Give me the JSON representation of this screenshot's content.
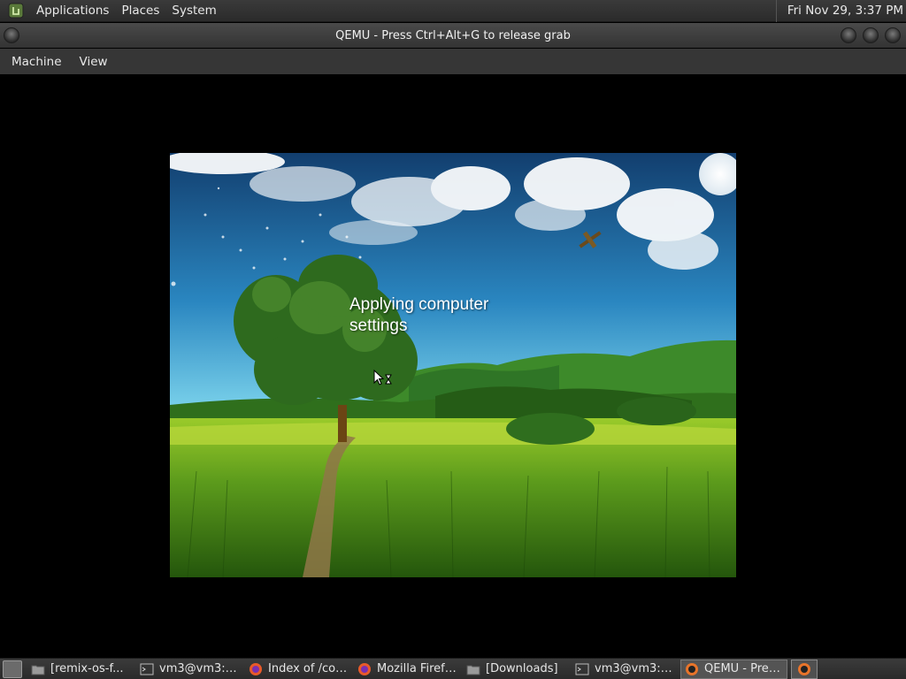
{
  "top_panel": {
    "menus": [
      "Applications",
      "Places",
      "System"
    ],
    "clock": "Fri Nov 29,  3:37 PM"
  },
  "window": {
    "title": "QEMU - Press Ctrl+Alt+G to release grab",
    "menubar": [
      "Machine",
      "View"
    ]
  },
  "guest": {
    "status_line1": "Applying computer",
    "status_line2": "settings"
  },
  "taskbar": {
    "items": [
      {
        "label": "[remix-os-f...",
        "icon": "folder-icon"
      },
      {
        "label": "vm3@vm3:~...",
        "icon": "terminal-icon"
      },
      {
        "label": "Index of /col...",
        "icon": "firefox-icon"
      },
      {
        "label": "Mozilla Firefox",
        "icon": "firefox-icon"
      },
      {
        "label": "[Downloads]",
        "icon": "folder-icon"
      },
      {
        "label": "vm3@vm3:~...",
        "icon": "terminal-icon"
      },
      {
        "label": "QEMU - Pres...",
        "icon": "qemu-icon",
        "active": true
      }
    ]
  },
  "colors": {
    "panel": "#2b2b2b",
    "sky_top": "#1f5f9a",
    "grass": "#6fae25"
  }
}
